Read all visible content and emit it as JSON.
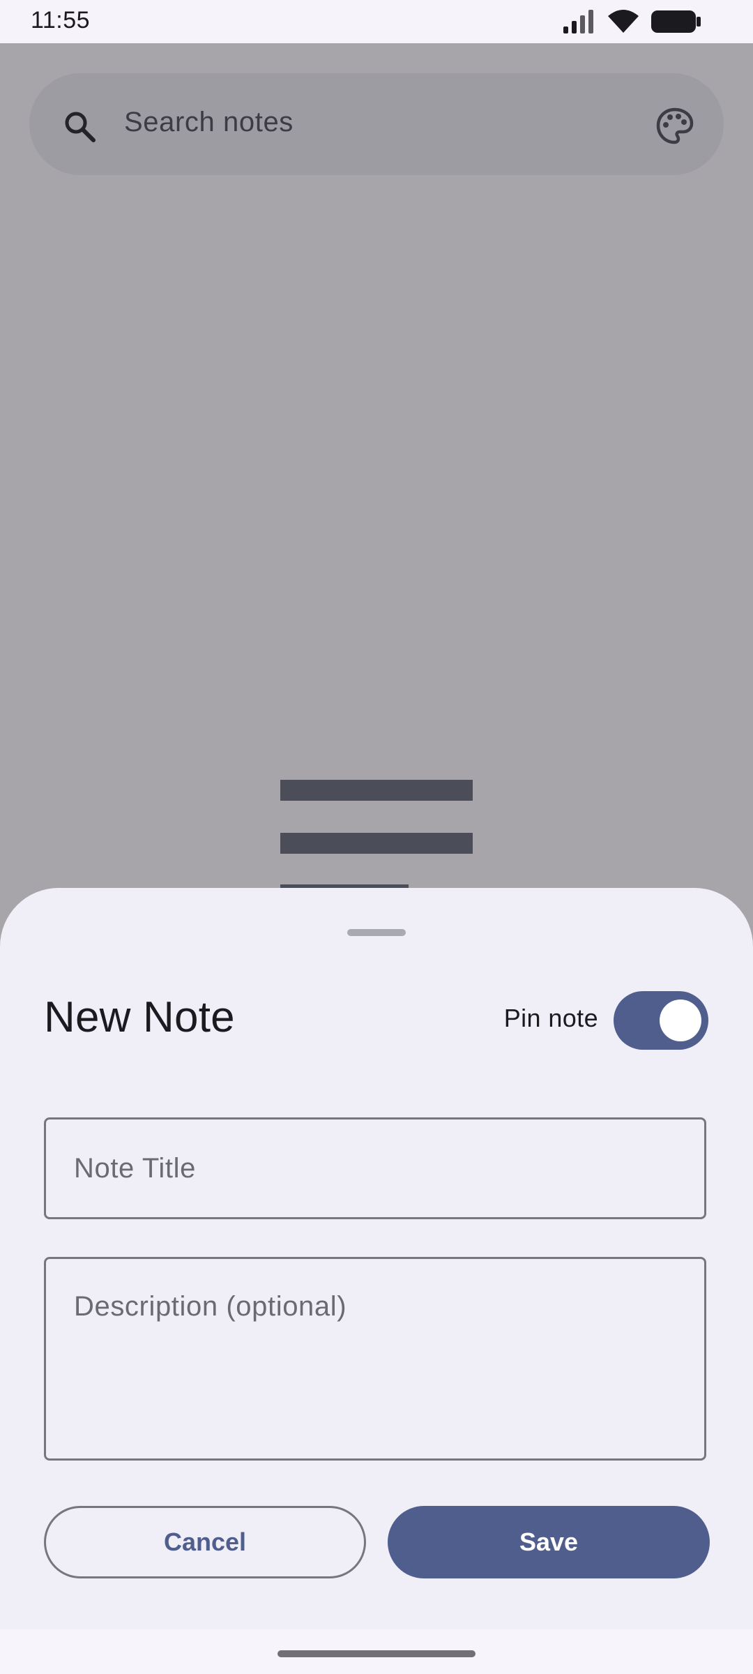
{
  "status_bar": {
    "time": "11:55"
  },
  "search": {
    "placeholder": "Search notes",
    "icon": "search-icon",
    "theme_icon": "palette-icon"
  },
  "sheet": {
    "title": "New Note",
    "pin_label": "Pin note",
    "pin_enabled": true,
    "title_placeholder": "Note Title",
    "description_placeholder": "Description (optional)",
    "cancel_label": "Cancel",
    "save_label": "Save"
  },
  "colors": {
    "primary": "#4f5e8c",
    "sheet_background": "#f0eff8",
    "outline": "#767680"
  }
}
